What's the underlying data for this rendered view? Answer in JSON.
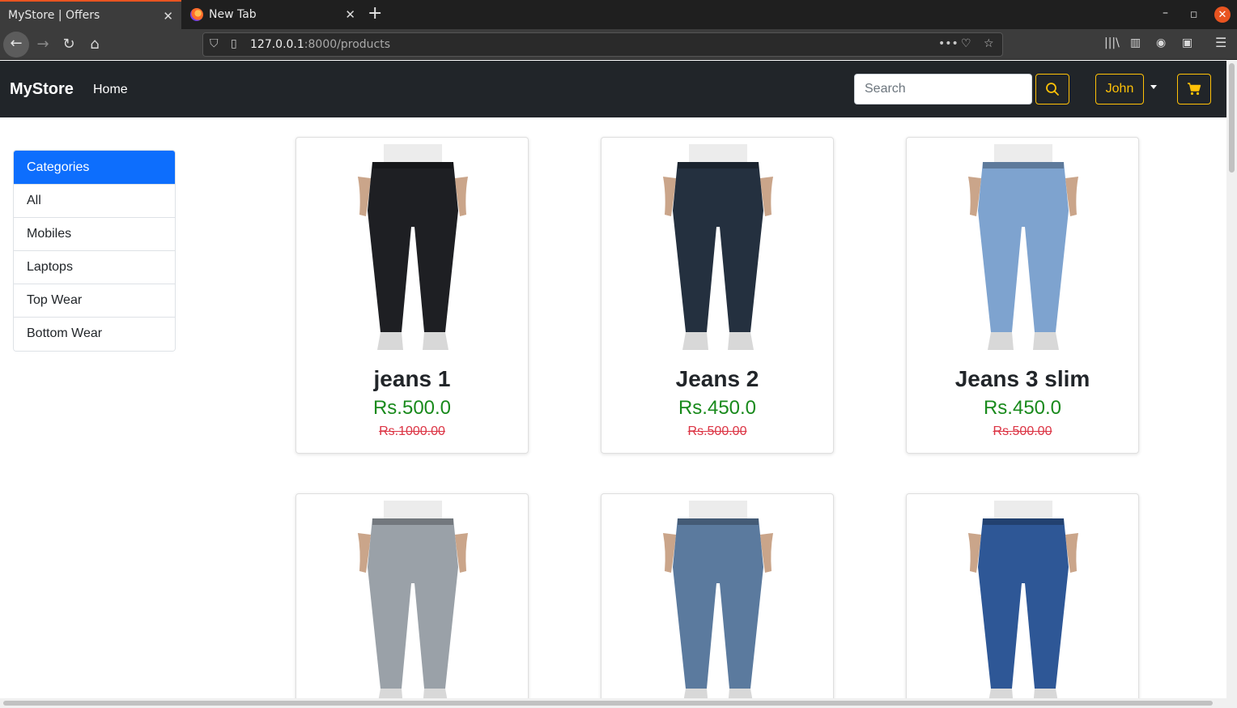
{
  "browser": {
    "tabs": [
      {
        "label": "MyStore | Offers",
        "active": true
      },
      {
        "label": "New Tab",
        "active": false
      }
    ],
    "url_host": "127.0.0.1",
    "url_rest": ":8000/products"
  },
  "site": {
    "brand": "MyStore",
    "nav_home": "Home",
    "search_placeholder": "Search",
    "user_label": "John",
    "accent_color": "#ffc107",
    "primary_color": "#0d6efd"
  },
  "categories": {
    "header": "Categories",
    "items": [
      "All",
      "Mobiles",
      "Laptops",
      "Top Wear",
      "Bottom Wear"
    ]
  },
  "products": [
    {
      "name": "jeans 1",
      "price": "Rs.500.0",
      "old_price": "Rs.1000.00",
      "shade": "#1e1f23"
    },
    {
      "name": "Jeans 2",
      "price": "Rs.450.0",
      "old_price": "Rs.500.00",
      "shade": "#24303f"
    },
    {
      "name": "Jeans 3 slim",
      "price": "Rs.450.0",
      "old_price": "Rs.500.00",
      "shade": "#7ea3cf"
    },
    {
      "name": "",
      "price": "",
      "old_price": "",
      "shade": "#9aa1a8"
    },
    {
      "name": "",
      "price": "",
      "old_price": "",
      "shade": "#5b7a9e"
    },
    {
      "name": "",
      "price": "",
      "old_price": "",
      "shade": "#2e5796"
    }
  ]
}
